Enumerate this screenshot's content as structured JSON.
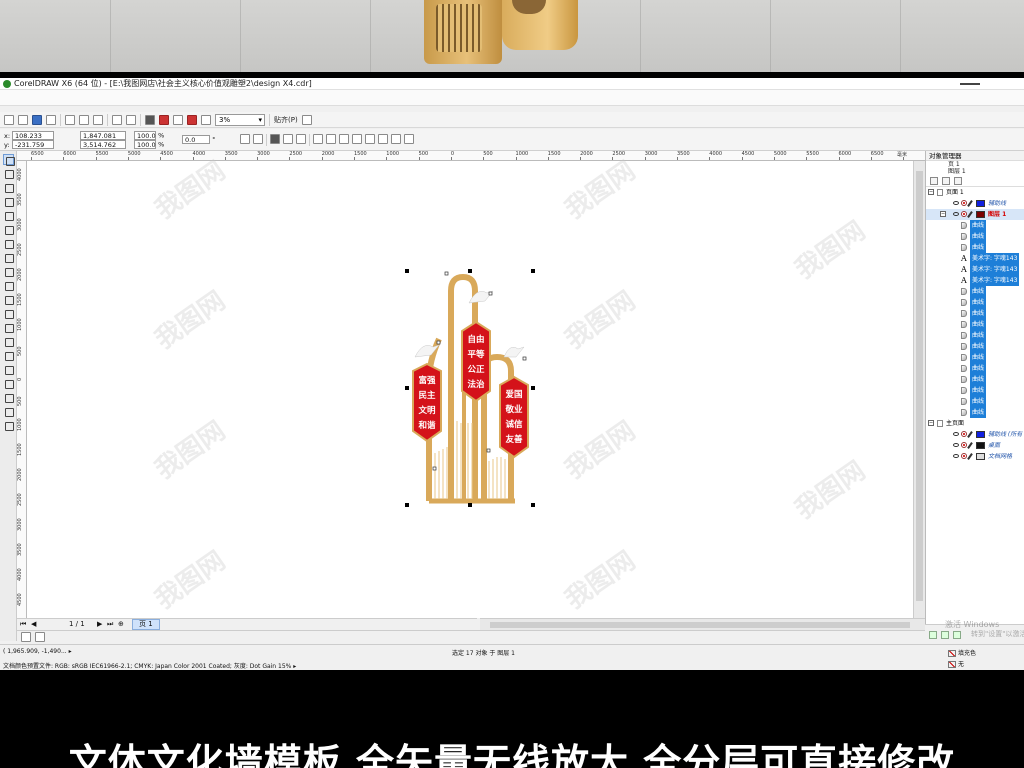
{
  "window": {
    "title": "CorelDRAW X6 (64 位) - [E:\\我图网店\\社会主义核心价值观雕塑2\\design X4.cdr]"
  },
  "toolbar": {
    "zoom_value": "3%",
    "snap_label": "贴齐(P)"
  },
  "property_bar": {
    "x_label": "x:",
    "x_value": "108.233 mm",
    "y_label": "y:",
    "y_value": "-231.759 mm",
    "width_value": "1,847.081 mm",
    "height_value": "3,514.762 mm",
    "scale_x": "100.0",
    "scale_y": "100.0",
    "percent": "%",
    "rotation_value": "0.0",
    "degree": "°"
  },
  "ruler": {
    "h_labels": [
      "6500",
      "6000",
      "5500",
      "5000",
      "4500",
      "4000",
      "3500",
      "3000",
      "2500",
      "2000",
      "1500",
      "1000",
      "500",
      "0",
      "500",
      "1000",
      "1500",
      "2000",
      "2500",
      "3000",
      "3500",
      "4000",
      "4500",
      "5000",
      "5500",
      "6000",
      "6500",
      "毫米"
    ],
    "v_labels": [
      "4000",
      "3500",
      "3000",
      "2500",
      "2000",
      "1500",
      "1000",
      "500",
      "0",
      "500",
      "1000",
      "1500",
      "2000",
      "2500",
      "3000",
      "3500",
      "4000",
      "4500"
    ]
  },
  "page_nav": {
    "page_count": "1 / 1",
    "page_tab": "页 1"
  },
  "status": {
    "cursor": "( 1,965.909, -1,490... ▸",
    "color_profile": "文档颜色预置文件: RGB: sRGB IEC61966-2.1; CMYK: Japan Color 2001 Coated; 灰度: Dot Gain 15% ▸",
    "selection": "选定 17 对象 于 图层 1",
    "fill_label": "填充色",
    "outline_label": "无"
  },
  "object_manager": {
    "title": "对象管理器",
    "page_label": "页 1",
    "layer_label": "图层 1",
    "page1_node": "页面 1",
    "guides_layer": "辅助线",
    "layer1": "图层 1",
    "items": [
      "曲线",
      "曲线",
      "曲线",
      "美术字: 字魂143",
      "美术字: 字魂143",
      "美术字: 字魂143",
      "曲线",
      "曲线",
      "曲线",
      "曲线",
      "曲线",
      "曲线",
      "曲线",
      "曲线",
      "曲线",
      "曲线",
      "曲线",
      "曲线"
    ],
    "master_node": "主页面",
    "master_guides": "辅助线 (所有",
    "desktop": "桌面",
    "doc_grid": "文档网格"
  },
  "artwork": {
    "left_panel": [
      "富强",
      "民主",
      "文明",
      "和谐"
    ],
    "center_panel": [
      "自由",
      "平等",
      "公正",
      "法治"
    ],
    "right_panel": [
      "爱国",
      "敬业",
      "诚信",
      "友善"
    ]
  },
  "watermark_text": "我图网",
  "os_watermark": "激活 Windows",
  "os_watermark_sub": "转到\"设置\"以激活 Windows。",
  "caption": "文体文化墙模板  全矢量无线放大 全分层可直接修改",
  "colors": {
    "gold": "#d9a95a",
    "red": "#d4121a",
    "select_blue": "#1e7fd8"
  }
}
